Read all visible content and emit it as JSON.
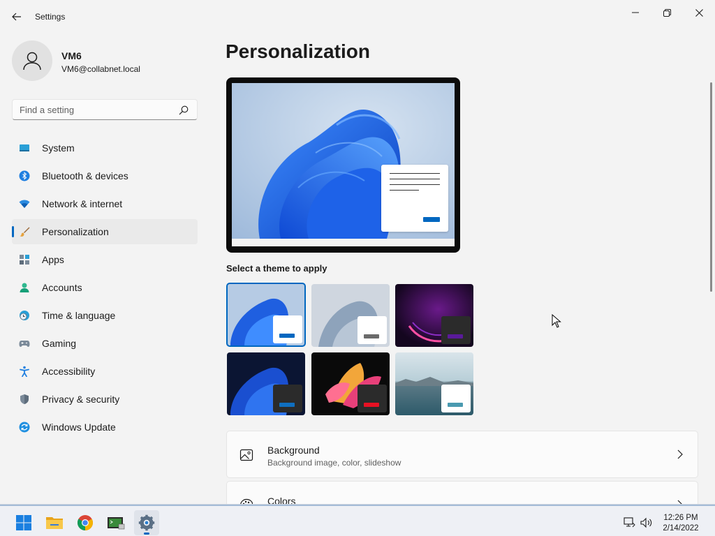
{
  "window": {
    "app_title": "Settings"
  },
  "user": {
    "name": "VM6",
    "email": "VM6@collabnet.local"
  },
  "search": {
    "placeholder": "Find a setting"
  },
  "sidebar": {
    "items": [
      {
        "label": "System",
        "icon": "system-icon"
      },
      {
        "label": "Bluetooth & devices",
        "icon": "bluetooth-icon"
      },
      {
        "label": "Network & internet",
        "icon": "wifi-icon"
      },
      {
        "label": "Personalization",
        "icon": "brush-icon",
        "active": true
      },
      {
        "label": "Apps",
        "icon": "apps-icon"
      },
      {
        "label": "Accounts",
        "icon": "accounts-icon"
      },
      {
        "label": "Time & language",
        "icon": "clock-globe-icon"
      },
      {
        "label": "Gaming",
        "icon": "gamepad-icon"
      },
      {
        "label": "Accessibility",
        "icon": "accessibility-icon"
      },
      {
        "label": "Privacy & security",
        "icon": "shield-icon"
      },
      {
        "label": "Windows Update",
        "icon": "update-icon"
      }
    ]
  },
  "main": {
    "page_title": "Personalization",
    "theme_section_label": "Select a theme to apply",
    "themes": [
      {
        "name": "windows-light",
        "selected": true
      },
      {
        "name": "windows-glow"
      },
      {
        "name": "captured-motion"
      },
      {
        "name": "windows-dark"
      },
      {
        "name": "flow"
      },
      {
        "name": "sunrise"
      }
    ],
    "cards": [
      {
        "title": "Background",
        "subtitle": "Background image, color, slideshow",
        "icon": "picture-icon"
      },
      {
        "title": "Colors",
        "subtitle": "",
        "icon": "palette-icon"
      }
    ]
  },
  "taskbar": {
    "apps": [
      "start-icon",
      "file-explorer-icon",
      "chrome-icon",
      "terminal-icon",
      "settings-icon"
    ],
    "time": "12:26 PM",
    "date": "2/14/2022"
  },
  "colors": {
    "accent": "#0067c0",
    "background": "#f3f3f3"
  }
}
